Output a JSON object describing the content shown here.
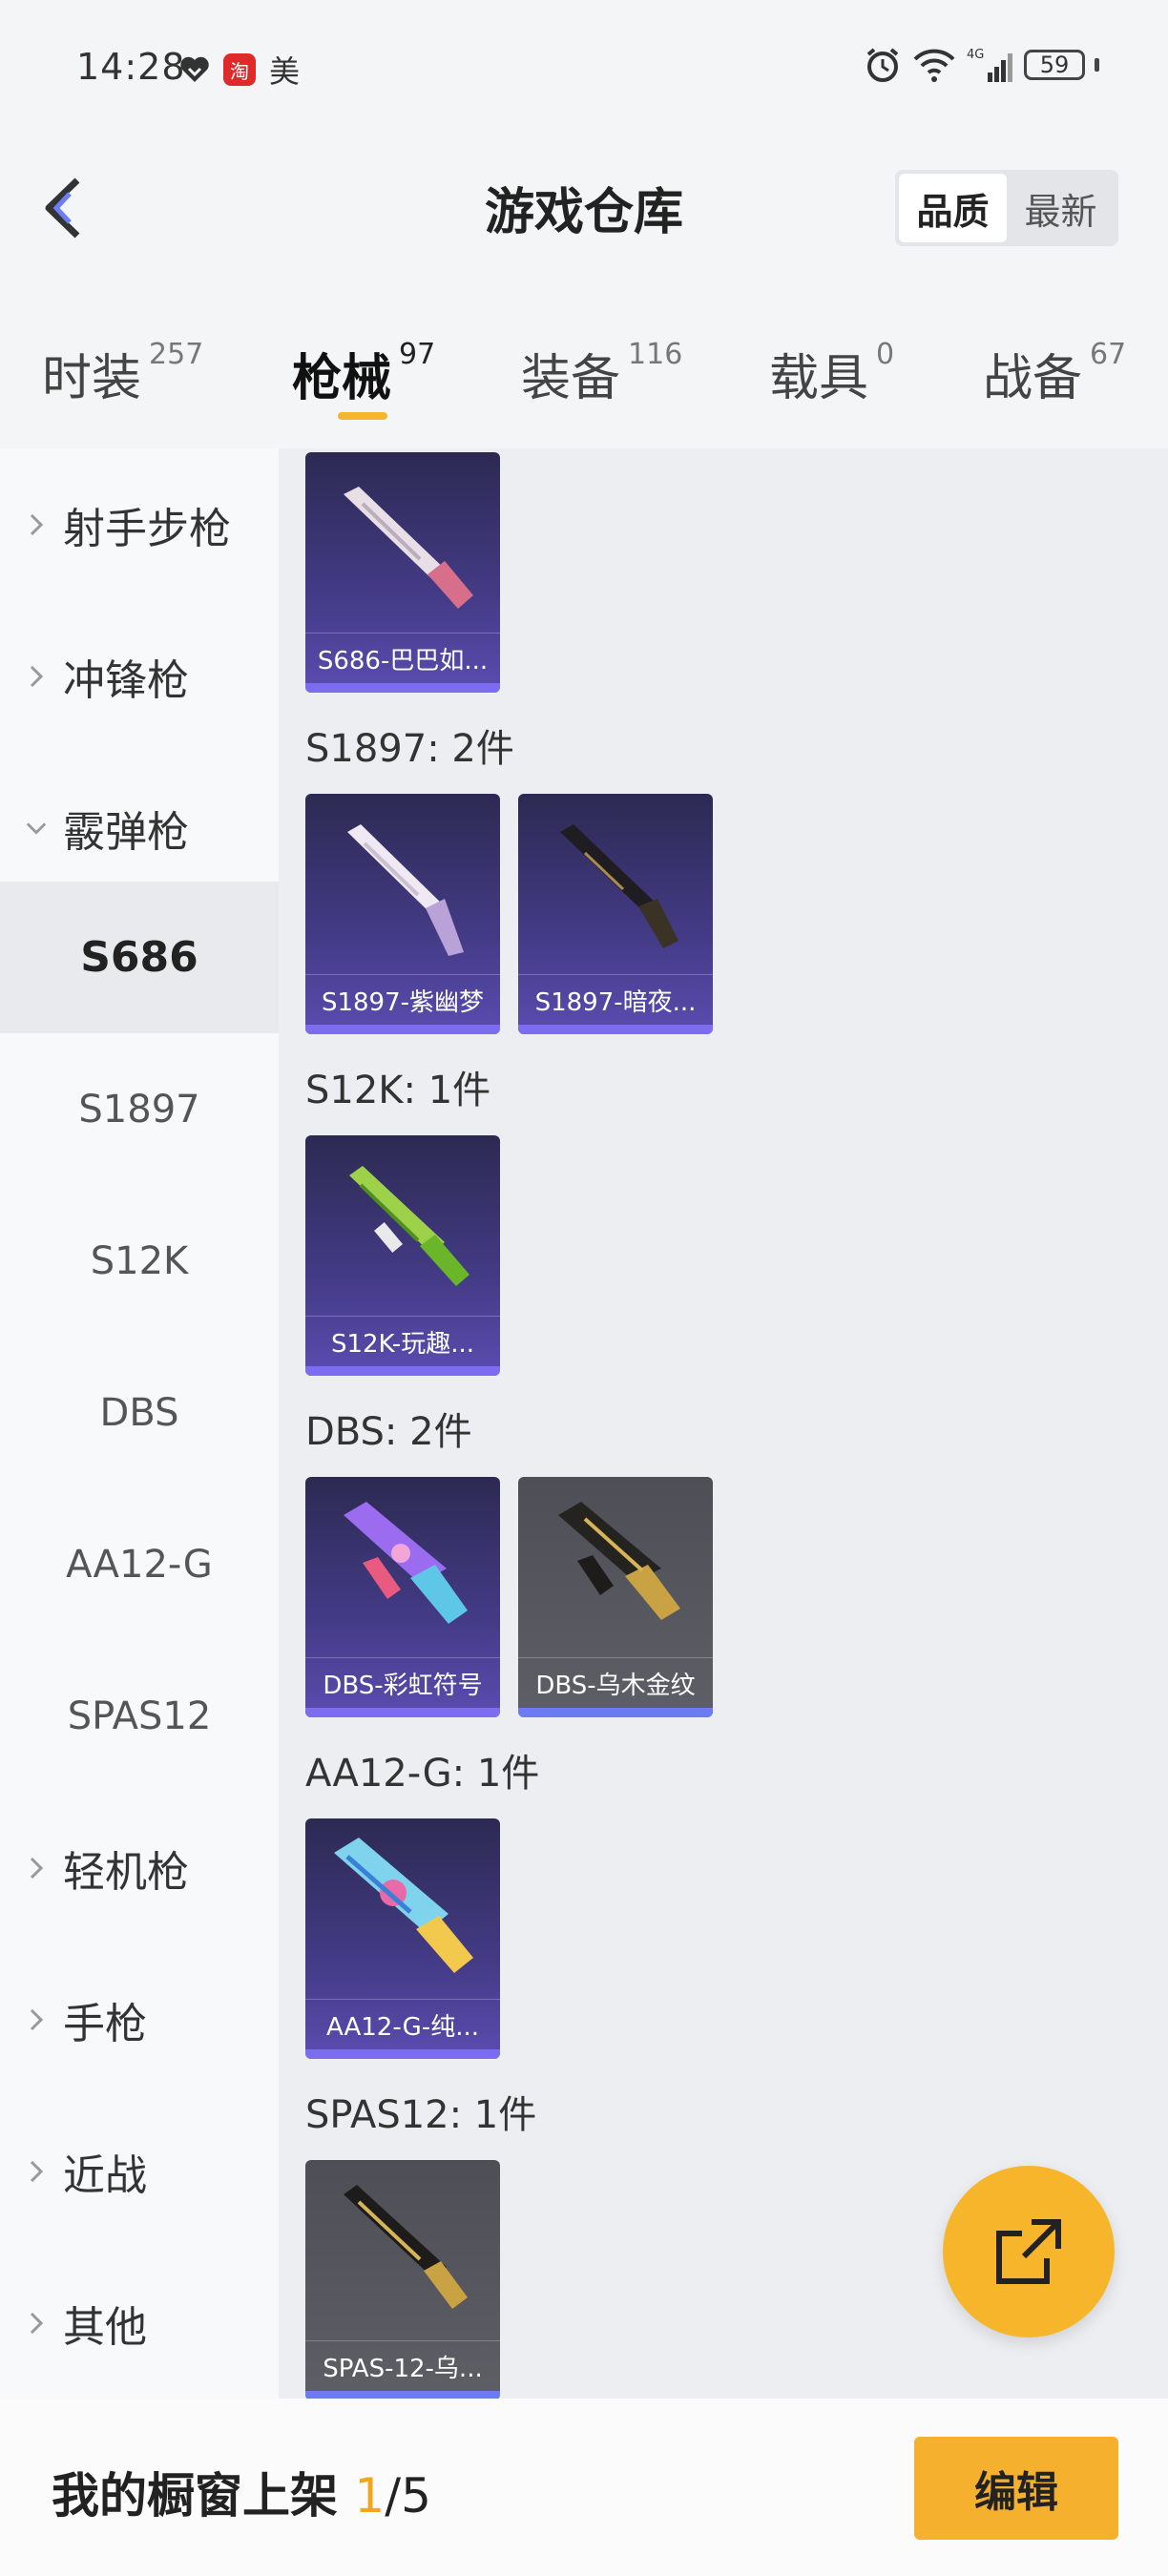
{
  "status_bar": {
    "time": "14:28",
    "carrier_text": "美",
    "battery": "59",
    "network": "4G"
  },
  "header": {
    "title": "游戏仓库",
    "sort_options": [
      "品质",
      "最新"
    ],
    "sort_active": "品质"
  },
  "category_tabs": [
    {
      "label": "时装",
      "count": "257"
    },
    {
      "label": "枪械",
      "count": "97",
      "active": true
    },
    {
      "label": "装备",
      "count": "116"
    },
    {
      "label": "载具",
      "count": "0"
    },
    {
      "label": "战备",
      "count": "67"
    }
  ],
  "sidebar": {
    "items": [
      {
        "label": "射手步枪",
        "type": "group",
        "expanded": false
      },
      {
        "label": "冲锋枪",
        "type": "group",
        "expanded": false
      },
      {
        "label": "霰弹枪",
        "type": "group",
        "expanded": true
      },
      {
        "label": "S686",
        "type": "sub",
        "selected": true
      },
      {
        "label": "S1897",
        "type": "sub"
      },
      {
        "label": "S12K",
        "type": "sub"
      },
      {
        "label": "DBS",
        "type": "sub"
      },
      {
        "label": "AA12-G",
        "type": "sub"
      },
      {
        "label": "SPAS12",
        "type": "sub"
      },
      {
        "label": "轻机枪",
        "type": "group",
        "expanded": false
      },
      {
        "label": "手枪",
        "type": "group",
        "expanded": false
      },
      {
        "label": "近战",
        "type": "group",
        "expanded": false
      },
      {
        "label": "其他",
        "type": "group",
        "expanded": false
      }
    ]
  },
  "groups": [
    {
      "title": "",
      "items": [
        {
          "caption": "S686-巴巴如...",
          "tier": "purple",
          "icon": "shotgun-pink-icon"
        }
      ]
    },
    {
      "title": "S1897: 2件",
      "items": [
        {
          "caption": "S1897-紫幽梦",
          "tier": "purple",
          "icon": "shotgun-lilac-icon"
        },
        {
          "caption": "S1897-暗夜...",
          "tier": "purple",
          "icon": "shotgun-dark-icon"
        }
      ]
    },
    {
      "title": "S12K: 1件",
      "items": [
        {
          "caption": "S12K-玩趣...",
          "tier": "purple",
          "icon": "shotgun-green-icon"
        }
      ]
    },
    {
      "title": "DBS: 2件",
      "items": [
        {
          "caption": "DBS-彩虹符号",
          "tier": "purple",
          "icon": "shotgun-rainbow-icon"
        },
        {
          "caption": "DBS-乌木金纹",
          "tier": "gray",
          "icon": "shotgun-gold-icon"
        }
      ]
    },
    {
      "title": "AA12-G: 1件",
      "items": [
        {
          "caption": "AA12-G-纯...",
          "tier": "purple",
          "icon": "shotgun-blue-icon"
        }
      ]
    },
    {
      "title": "SPAS12: 1件",
      "items": [
        {
          "caption": "SPAS-12-乌...",
          "tier": "gray",
          "icon": "shotgun-black-gold-icon"
        }
      ]
    }
  ],
  "colors": {
    "accent": "#f5b02d",
    "purple_tier": "#443b87",
    "gray_tier": "#5e5f66"
  },
  "bottom_bar": {
    "label": "我的橱窗上架",
    "current": "1",
    "total": "/5",
    "edit_label": "编辑"
  }
}
